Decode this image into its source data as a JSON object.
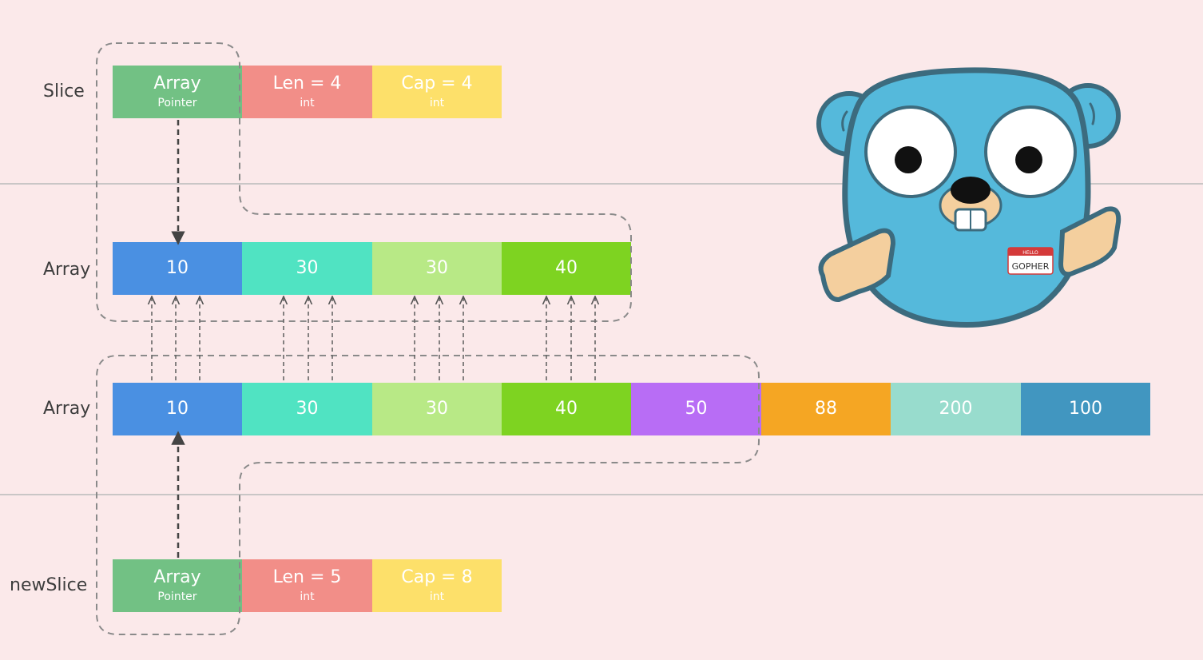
{
  "labels": {
    "slice": "Slice",
    "array_top": "Array",
    "array_bottom": "Array",
    "new_slice": "newSlice"
  },
  "slice_header": {
    "pointer": {
      "main": "Array",
      "sub": "Pointer"
    },
    "len": {
      "main": "Len = 4",
      "sub": "int"
    },
    "cap": {
      "main": "Cap = 4",
      "sub": "int"
    }
  },
  "new_slice_header": {
    "pointer": {
      "main": "Array",
      "sub": "Pointer"
    },
    "len": {
      "main": "Len = 5",
      "sub": "int"
    },
    "cap": {
      "main": "Cap = 8",
      "sub": "int"
    }
  },
  "array_top": [
    "10",
    "30",
    "30",
    "40"
  ],
  "array_bottom": [
    "10",
    "30",
    "30",
    "40",
    "50",
    "88",
    "200",
    "100"
  ],
  "gopher_badge": {
    "top": "HELLO",
    "name": "GOPHER"
  },
  "colors": {
    "background": "#fbe9ea",
    "pointer": "#72c184",
    "len": "#f28e88",
    "cap": "#fde06a",
    "cells": [
      "#4a90e2",
      "#50e3c2",
      "#b8e986",
      "#7ed321",
      "#b86df5",
      "#f5a623",
      "#98dccd",
      "#4196c0"
    ],
    "gopher": "#55b9db"
  }
}
